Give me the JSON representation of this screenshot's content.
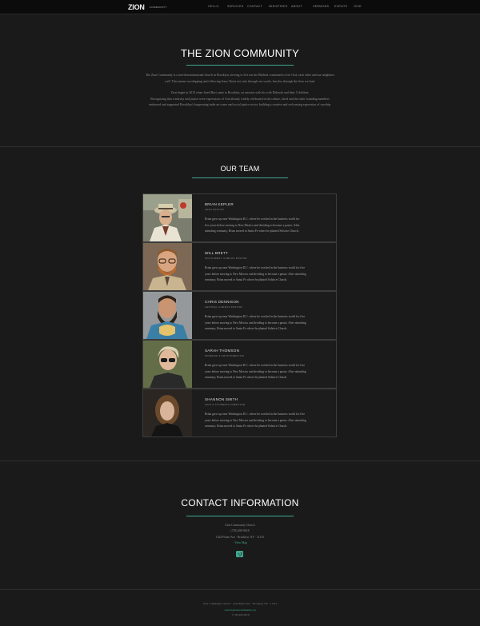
{
  "nav": {
    "logo": "ZION",
    "logo_sub": "COMMUNITY",
    "items": [
      "HELLO",
      "SERVICES",
      "CONTACT",
      "MINISTRIES",
      "ABOUT",
      "SERMONS",
      "EVENTS",
      "GIVE"
    ]
  },
  "about": {
    "title": "THE ZION COMMUNITY",
    "para1_line1": "The Zion Community is a non-denominational church in Brooklyn, striving to live out the Biblical command to love God, each other and our neighbors",
    "para1_line2": "well. This means worshipping and following Jesus Christ not only through our words, but also through the lives we lead.",
    "para2_line1": "Zion began in 2010 when Jared Hurt came to Brooklyn, on mission with his wife Deborah and their 5 children.",
    "para2_line2": "Recognizing that creativity and justice were expressions of God already widely celebrated in the culture, Jared and the other founding members",
    "para2_line3": "embraced and supported Brooklyn's burgeoning indie art scene and social justice sector, building a creative and welcoming expression of worship."
  },
  "team": {
    "title": "OUR TEAM",
    "members": [
      {
        "name": "BRIAN KEPLER",
        "role": "LEAD PASTOR",
        "bio1": "Brian grew up near Washington D.C. where he worked in the business world for",
        "bio2": "five years before moving to New Mexico and deciding to become a pastor. After",
        "bio3": "attending seminary, Brian moved to Santa Fe where he planted Solstice Church."
      },
      {
        "name": "WILL BRETT",
        "role": "SOUTHWEST CAMPUS PASTOR",
        "bio1": "Brian grew up near Washington D.C. where he worked in the business world for five",
        "bio2": "years before moving to New Mexico and deciding to become a pastor. After attending",
        "bio3": "seminary, Brian moved to Santa Fe where he planted Solstice Church."
      },
      {
        "name": "CHRIS DENNISON",
        "role": "CENTRAL CAMPUS PASTOR",
        "bio1": "Brian grew up near Washington D.C. where he worked in the business world for five",
        "bio2": "years before moving to New Mexico and deciding to become a pastor. After attending",
        "bio3": "seminary, Brian moved to Santa Fe where he planted Solstice Church."
      },
      {
        "name": "SARAH THOMSON",
        "role": "WORSHIP & ARTS DIRECTOR",
        "bio1": "Brian grew up near Washington D.C. where he worked in the business world for five",
        "bio2": "years before moving to New Mexico and deciding to become a pastor. After attending",
        "bio3": "seminary, Brian moved to Santa Fe where he planted Solstice Church."
      },
      {
        "name": "SHANNON SMITH",
        "role": "KIDS & STUDENTS DIRECTOR",
        "bio1": "Brian grew up near Washington D.C. where he worked in the business world for five",
        "bio2": "years before moving to New Mexico and deciding to become a pastor. After attending",
        "bio3": "seminary, Brian moved to Santa Fe where he planted Solstice Church."
      }
    ]
  },
  "contact": {
    "title": "CONTACT INFORMATION",
    "org": "Zion Community Church",
    "phone": "(718) 499-9018",
    "address": "1424 Fisher Ave · Brooklyn, NY · 11215",
    "map_link": "View Map",
    "social_icon": "vimeo-icon",
    "accent": "#3fa88f"
  },
  "footer": {
    "line1": "Zion Community Church · 1424 Fisher Ave · Brooklyn, NY · 11215",
    "email": "contact@zioncommunity.org",
    "phone": "· (718) 499-9018"
  }
}
